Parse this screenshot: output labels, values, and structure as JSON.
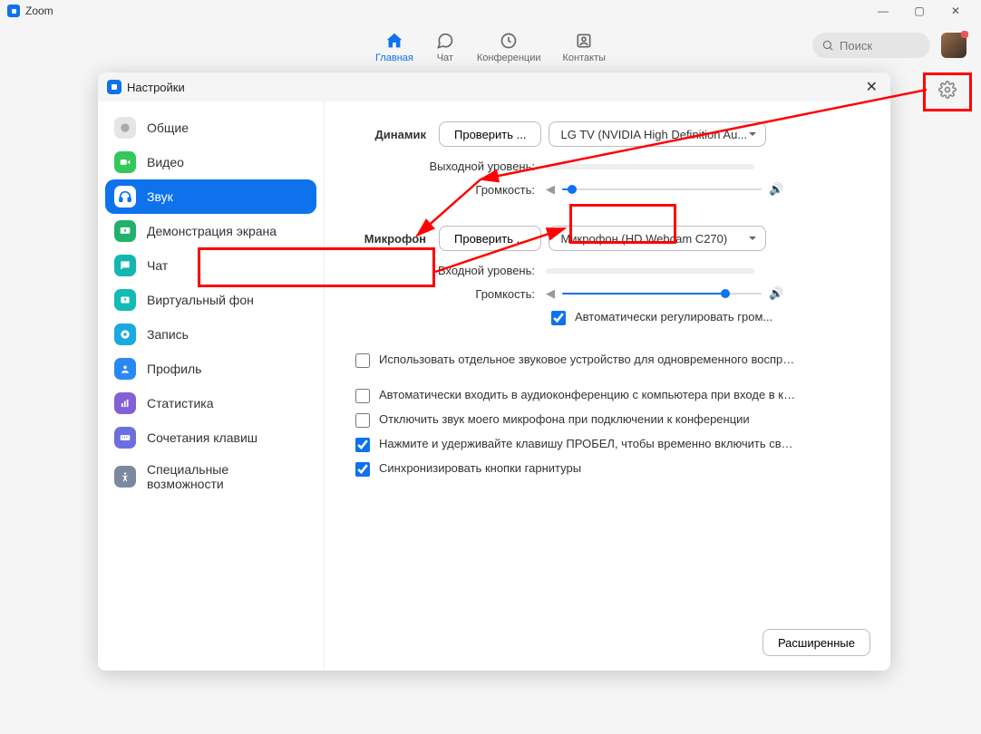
{
  "app": {
    "title": "Zoom"
  },
  "nav": {
    "home": "Главная",
    "chat": "Чат",
    "meetings": "Конференции",
    "contacts": "Контакты"
  },
  "search": {
    "placeholder": "Поиск"
  },
  "modal_title": "Настройки",
  "sidebar": {
    "general": "Общие",
    "video": "Видео",
    "audio": "Звук",
    "share": "Демонстрация экрана",
    "chat": "Чат",
    "vback": "Виртуальный фон",
    "record": "Запись",
    "profile": "Профиль",
    "stats": "Статистика",
    "keys": "Сочетания клавиш",
    "access": "Специальные возможности"
  },
  "audio": {
    "speaker_label": "Динамик",
    "speaker_test": "Проверить ...",
    "speaker_device": "LG TV (NVIDIA High Definition Au...",
    "output_level": "Выходной уровень:",
    "volume_label": "Громкость:",
    "mic_label": "Микрофон",
    "mic_test": "Проверить ...",
    "mic_device": "Микрофон (HD Webcam C270)",
    "input_level": "Входной уровень:",
    "auto_mic": "Автоматически регулировать гром...",
    "chk_dedicated": "Использовать отдельное звуковое устройство для одновременного воспро...",
    "chk_autojoin": "Автоматически входить в аудиоконференцию с компьютера при входе в кон...",
    "chk_mute": "Отключить звук моего микрофона при подключении к конференции",
    "chk_space": "Нажмите и удерживайте клавишу ПРОБЕЛ, чтобы временно включить свой з...",
    "chk_headset": "Синхронизировать кнопки гарнитуры",
    "advanced": "Расширенные",
    "speaker_volume_pct": 5,
    "mic_volume_pct": 82
  }
}
